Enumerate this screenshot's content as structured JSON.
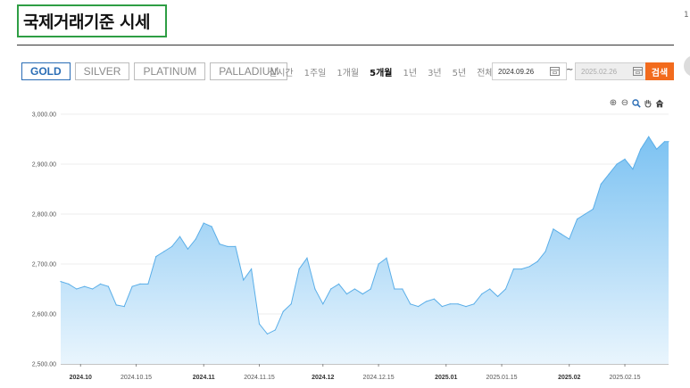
{
  "page": {
    "title": "국제거래기준 시세",
    "edge_char": "1"
  },
  "metal_tabs": [
    {
      "label": "GOLD",
      "active": true
    },
    {
      "label": "SILVER",
      "active": false
    },
    {
      "label": "PLATINUM",
      "active": false
    },
    {
      "label": "PALLADIUM",
      "active": false
    }
  ],
  "period_tabs": [
    {
      "label": "실시간",
      "active": false
    },
    {
      "label": "1주일",
      "active": false
    },
    {
      "label": "1개월",
      "active": false
    },
    {
      "label": "5개월",
      "active": true
    },
    {
      "label": "1년",
      "active": false
    },
    {
      "label": "3년",
      "active": false
    },
    {
      "label": "5년",
      "active": false
    },
    {
      "label": "전체",
      "active": false
    }
  ],
  "date_range": {
    "start": "2024.09.26",
    "separator": "~",
    "end": "2025.02.26"
  },
  "search_label": "검색",
  "chart_tools": [
    "zoom-in-icon",
    "zoom-out-icon",
    "magnify-icon",
    "pan-hand-icon",
    "home-icon"
  ],
  "colors": {
    "accent": "#f26b1d",
    "active_tab": "#2a6db5",
    "line": "#5aaee8",
    "area_top": "#7cc2f2",
    "area_bottom": "#e9f5fd",
    "title_border": "#2e9e44"
  },
  "chart_data": {
    "type": "area",
    "ylim": [
      2500,
      3000
    ],
    "y_ticks": [
      "2,500.00",
      "2,600.00",
      "2,700.00",
      "2,800.00",
      "2,900.00",
      "3,000.00"
    ],
    "x_ticks": [
      {
        "label": "2024.10",
        "bold": true,
        "x": "2024-10-01"
      },
      {
        "label": "2024.10.15",
        "bold": false,
        "x": "2024-10-15"
      },
      {
        "label": "2024.11",
        "bold": true,
        "x": "2024-11-01"
      },
      {
        "label": "2024.11.15",
        "bold": false,
        "x": "2024-11-15"
      },
      {
        "label": "2024.12",
        "bold": true,
        "x": "2024-12-01"
      },
      {
        "label": "2024.12.15",
        "bold": false,
        "x": "2024-12-15"
      },
      {
        "label": "2025.01",
        "bold": true,
        "x": "2025-01-01"
      },
      {
        "label": "2025.01.15",
        "bold": false,
        "x": "2025-01-15"
      },
      {
        "label": "2025.02",
        "bold": true,
        "x": "2025-02-01"
      },
      {
        "label": "2025.02.15",
        "bold": false,
        "x": "2025-02-15"
      }
    ],
    "x_range": [
      "2024-09-26",
      "2025-02-26"
    ],
    "series": [
      {
        "x": [
          "2024-09-26",
          "2024-09-28",
          "2024-09-30",
          "2024-10-02",
          "2024-10-04",
          "2024-10-06",
          "2024-10-08",
          "2024-10-10",
          "2024-10-12",
          "2024-10-14",
          "2024-10-16",
          "2024-10-18",
          "2024-10-20",
          "2024-10-22",
          "2024-10-24",
          "2024-10-26",
          "2024-10-28",
          "2024-10-30",
          "2024-11-01",
          "2024-11-03",
          "2024-11-05",
          "2024-11-07",
          "2024-11-09",
          "2024-11-11",
          "2024-11-13",
          "2024-11-15",
          "2024-11-17",
          "2024-11-19",
          "2024-11-21",
          "2024-11-23",
          "2024-11-25",
          "2024-11-27",
          "2024-11-29",
          "2024-12-01",
          "2024-12-03",
          "2024-12-05",
          "2024-12-07",
          "2024-12-09",
          "2024-12-11",
          "2024-12-13",
          "2024-12-15",
          "2024-12-17",
          "2024-12-19",
          "2024-12-21",
          "2024-12-23",
          "2024-12-25",
          "2024-12-27",
          "2024-12-29",
          "2024-12-31",
          "2025-01-02",
          "2025-01-04",
          "2025-01-06",
          "2025-01-08",
          "2025-01-10",
          "2025-01-12",
          "2025-01-14",
          "2025-01-16",
          "2025-01-18",
          "2025-01-20",
          "2025-01-22",
          "2025-01-24",
          "2025-01-26",
          "2025-01-28",
          "2025-01-30",
          "2025-02-01",
          "2025-02-03",
          "2025-02-05",
          "2025-02-07",
          "2025-02-09",
          "2025-02-11",
          "2025-02-13",
          "2025-02-15",
          "2025-02-17",
          "2025-02-19",
          "2025-02-21",
          "2025-02-23",
          "2025-02-25",
          "2025-02-26"
        ],
        "y": [
          2665,
          2660,
          2650,
          2655,
          2650,
          2660,
          2655,
          2618,
          2615,
          2655,
          2660,
          2660,
          2715,
          2725,
          2735,
          2755,
          2730,
          2750,
          2782,
          2775,
          2740,
          2735,
          2735,
          2668,
          2690,
          2580,
          2560,
          2568,
          2605,
          2620,
          2690,
          2712,
          2650,
          2620,
          2650,
          2660,
          2640,
          2650,
          2640,
          2650,
          2700,
          2712,
          2650,
          2650,
          2620,
          2615,
          2625,
          2630,
          2615,
          2620,
          2620,
          2615,
          2620,
          2640,
          2650,
          2635,
          2650,
          2690,
          2690,
          2695,
          2705,
          2725,
          2770,
          2760,
          2750,
          2790,
          2800,
          2810,
          2860,
          2880,
          2900,
          2910,
          2890,
          2930,
          2955,
          2930,
          2945,
          2945
        ]
      }
    ]
  }
}
